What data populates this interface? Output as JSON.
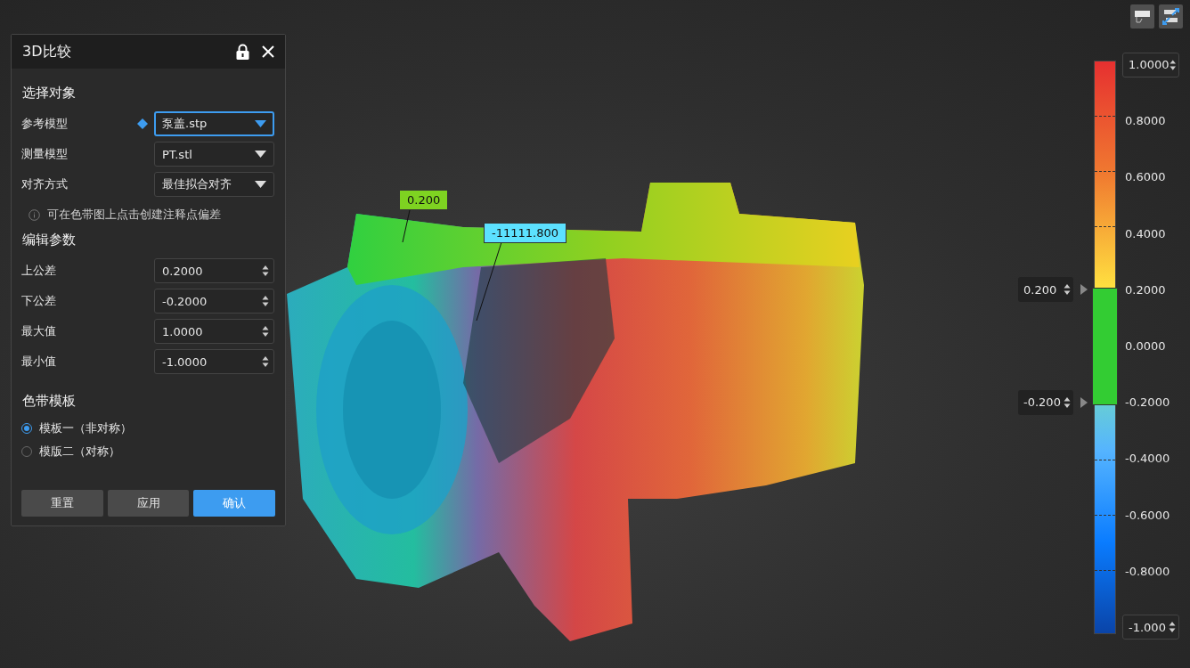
{
  "panel": {
    "title": "3D比较"
  },
  "select_section": {
    "heading": "选择对象",
    "rows": [
      {
        "label": "参考模型",
        "value": "泵盖.stp",
        "focused": true,
        "marker": true
      },
      {
        "label": "测量模型",
        "value": "PT.stl",
        "focused": false,
        "marker": false
      },
      {
        "label": "对齐方式",
        "value": "最佳拟合对齐",
        "focused": false,
        "marker": false
      }
    ],
    "hint": "可在色带图上点击创建注释点偏差"
  },
  "params_section": {
    "heading": "编辑参数",
    "rows": [
      {
        "label": "上公差",
        "value": "0.2000"
      },
      {
        "label": "下公差",
        "value": "-0.2000"
      },
      {
        "label": "最大值",
        "value": "1.0000"
      },
      {
        "label": "最小值",
        "value": "-1.0000"
      }
    ]
  },
  "template_section": {
    "heading": "色带模板",
    "options": [
      {
        "label": "模板一（非对称）",
        "selected": true
      },
      {
        "label": "模版二（对称）",
        "selected": false
      }
    ]
  },
  "buttons": [
    {
      "label": "重置",
      "primary": false
    },
    {
      "label": "应用",
      "primary": false
    },
    {
      "label": "确认",
      "primary": true
    }
  ],
  "viewport": {
    "annotations": [
      {
        "value": "0.200",
        "color": "#7ed321"
      },
      {
        "value": "-11111.800",
        "color": "#5ce1ff"
      }
    ]
  },
  "color_bar": {
    "max_input": "1.0000",
    "min_input": "-1.000",
    "upper_tolerance_input": "0.200",
    "lower_tolerance_input": "-0.200",
    "labels": [
      "0.8000",
      "0.6000",
      "0.4000",
      "0.2000",
      "0.0000",
      "-0.2000",
      "-0.4000",
      "-0.6000",
      "-0.8000"
    ]
  }
}
